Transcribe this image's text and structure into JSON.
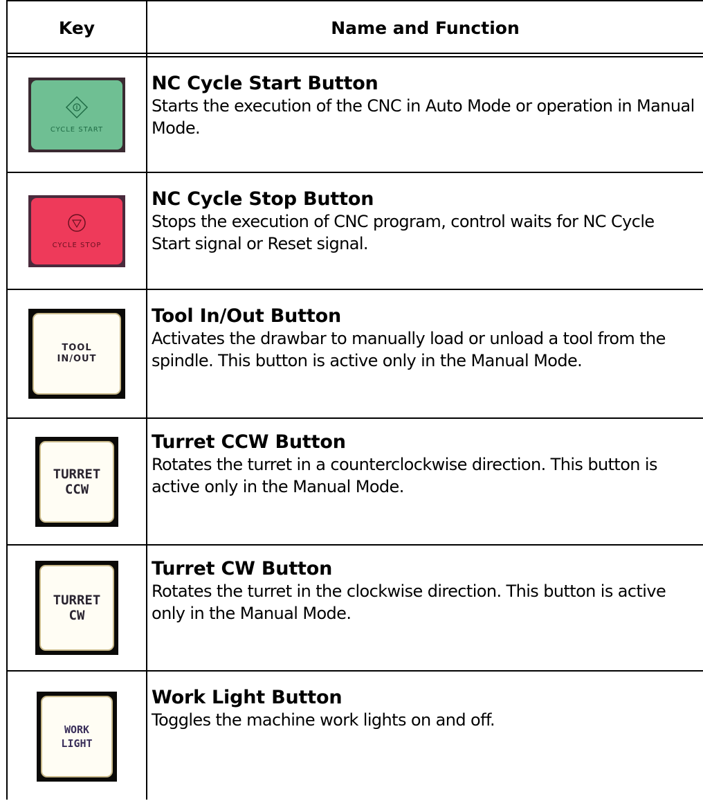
{
  "header": {
    "key": "Key",
    "name": "Name and Function"
  },
  "rows": [
    {
      "title": "NC Cycle Start Button",
      "description": "Starts the execution of the CNC in Auto Mode or operation in Manual Mode.",
      "key_label": "CYCLE START",
      "key_color": "#6fbf93"
    },
    {
      "title": "NC Cycle Stop Button",
      "description": "Stops the execution of CNC program, control waits for NC Cycle Start signal or Reset signal.",
      "key_label": "CYCLE STOP",
      "key_color": "#ee3a5a"
    },
    {
      "title": "Tool In/Out Button",
      "description": "Activates the drawbar to manually load or unload a tool from the spindle. This button is active only in the Manual Mode.",
      "key_label_line1": "TOOL",
      "key_label_line2": "IN/OUT"
    },
    {
      "title": "Turret CCW Button",
      "description": "Rotates the turret in a counterclockwise direction. This button is active only in the Manual Mode.",
      "key_label_line1": "TURRET",
      "key_label_line2": "CCW"
    },
    {
      "title": "Turret CW Button",
      "description": "Rotates the turret in the clockwise direction. This button is active only in the Manual Mode.",
      "key_label_line1": "TURRET",
      "key_label_line2": "CW"
    },
    {
      "title": "Work Light Button",
      "description": "Toggles the machine work lights on and off.",
      "key_label_line1": "WORK",
      "key_label_line2": "LIGHT"
    }
  ]
}
